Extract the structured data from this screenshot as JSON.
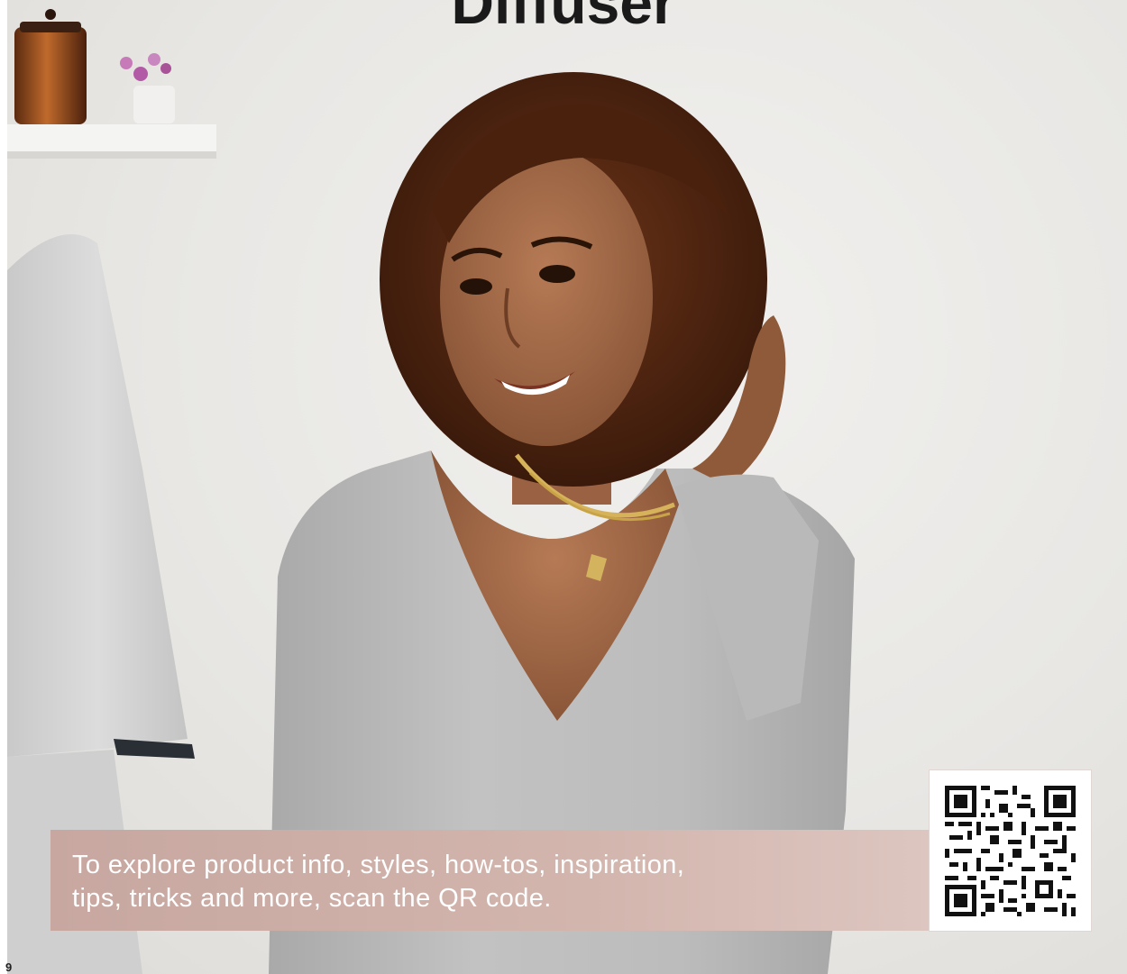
{
  "headline": "Diffuser",
  "promo": {
    "text_line1": "To explore product info, styles, how-tos, inspiration,",
    "text_line2": "tips, tricks and more, scan the QR code."
  },
  "page_number": "9",
  "colors": {
    "band": "#cfb0a9",
    "headline": "#1a1a1a",
    "promo_text": "#ffffff"
  },
  "qr_code_icon": "qr-code"
}
